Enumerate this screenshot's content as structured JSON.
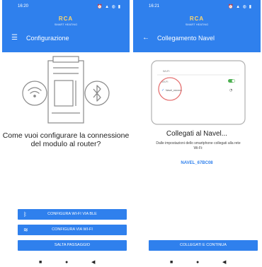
{
  "colors": {
    "accent": "#2f80ed",
    "brand": "#ffd66b"
  },
  "screen1": {
    "time": "16:20",
    "status_icons": "⏰ ▲ ◍ ▮",
    "brand": "RCA",
    "brand_sub": "SMART HEATING",
    "menu_icon": "hamburger-menu-icon",
    "title": "Configurazione",
    "question": "Come vuoi configurare la connessione del modulo al router?",
    "buttons": [
      {
        "icon": "bluetooth-icon",
        "label": "CONFIGURA WI-FI VIA BLE"
      },
      {
        "icon": "wifi-icon",
        "label": "CONFIGURA VIA WI-FI"
      },
      {
        "label": "SALTA PASSAGGIO"
      }
    ],
    "nav": [
      "■",
      "●",
      "◀"
    ]
  },
  "screen2": {
    "time": "16:21",
    "status_icons": "⏰ ▲ ◍ ▮",
    "brand": "RCA",
    "brand_sub": "SMART HEATING",
    "back_icon": "arrow-left-icon",
    "title": "Collegamento Navel",
    "illustration": {
      "wifi_label": "Wi-Fi",
      "section_label": "Wi-Fi",
      "network_label": "Navel_xxxxxxx"
    },
    "heading": "Collegati al Navel...",
    "description": "Dalle impostazioni dello smartphone collegati alla rete Wi-Fi:",
    "network_name": "NAVEL_67BC08",
    "button": "COLLEGATI E CONTINUA",
    "nav": [
      "■",
      "●",
      "◀"
    ]
  }
}
